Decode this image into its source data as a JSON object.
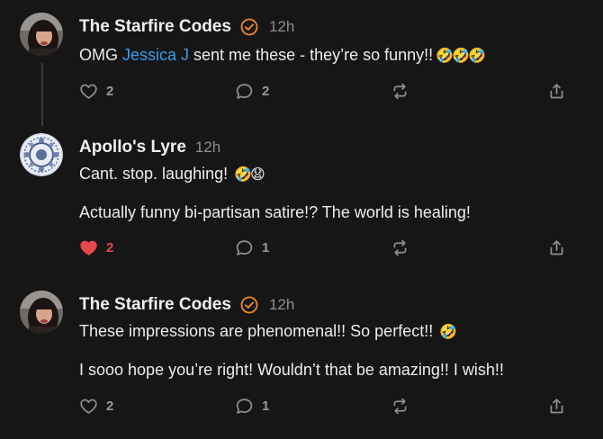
{
  "posts": [
    {
      "author": "The Starfire Codes",
      "verified": true,
      "time": "12h",
      "line1_before": "OMG ",
      "line1_mention": "Jessica J",
      "line1_after": " sent me these - they’re so funny!!",
      "line1_emoji": "🤣🤣🤣",
      "line2": "",
      "likes": "2",
      "liked": false,
      "replies": "2",
      "avatar": "woman-selfie-avatar"
    },
    {
      "author": "Apollo's Lyre",
      "verified": false,
      "time": "12h",
      "line1_before": "Cant. stop. laughing!",
      "line1_mention": "",
      "line1_after": "",
      "line1_emoji": "🤣😧",
      "line2": "Actually funny bi-partisan satire!? The world is healing!",
      "likes": "2",
      "liked": true,
      "replies": "1",
      "avatar": "mandala-pattern-avatar"
    },
    {
      "author": "The Starfire Codes",
      "verified": true,
      "time": "12h",
      "line1_before": "These impressions are phenomenal!! So perfect!!",
      "line1_mention": "",
      "line1_after": "",
      "line1_emoji": "🤣",
      "line2": "I sooo hope you’re right! Wouldn’t that be amazing!! I wish!!",
      "likes": "2",
      "liked": false,
      "replies": "1",
      "avatar": "woman-selfie-avatar"
    }
  ],
  "colors": {
    "background": "#161616",
    "mention": "#3b9cf0",
    "verified_badge": "#f08a24",
    "liked_heart": "#e5484d",
    "muted": "#8e8e8e"
  },
  "icons": [
    "heart-icon",
    "reply-bubble-icon",
    "repost-icon",
    "share-icon",
    "verified-badge-icon"
  ]
}
